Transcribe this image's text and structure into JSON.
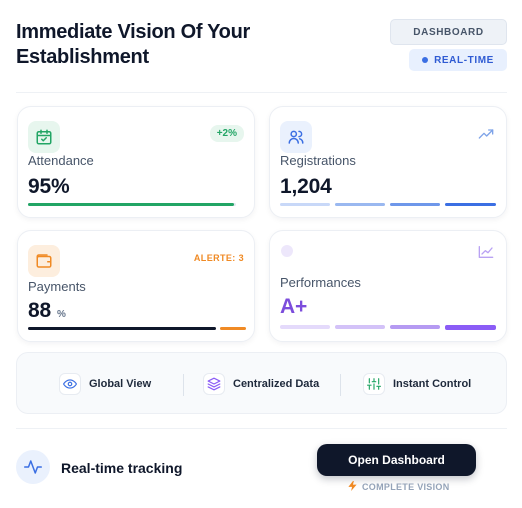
{
  "header": {
    "title": "Immediate Vision Of Your Establishment",
    "badge_dashboard": "DASHBOARD",
    "badge_realtime": "REAL-TIME"
  },
  "cards": {
    "attendance": {
      "label": "Attendance",
      "value": "95%",
      "badge": "+2%",
      "icon": "calendar-check-icon",
      "progress": 0.95
    },
    "registrations": {
      "label": "Registrations",
      "value": "1,204",
      "icon": "users-icon",
      "trend_icon": "trending-up-icon",
      "segments_filled": 4
    },
    "payments": {
      "label": "Payments",
      "value": "88",
      "unit": "%",
      "alert": "ALERTE: 3",
      "icon": "wallet-icon",
      "progress": 0.88
    },
    "performances": {
      "label": "Performances",
      "value": "A+",
      "icon": "chart-icon",
      "segments_filled": 4
    }
  },
  "features": [
    {
      "label": "Global View",
      "icon": "eye-icon"
    },
    {
      "label": "Centralized Data",
      "icon": "layers-icon"
    },
    {
      "label": "Instant Control",
      "icon": "sliders-icon"
    }
  ],
  "footer": {
    "tracking_label": "Real-time tracking",
    "tracking_icon": "activity-icon",
    "button_label": "Open Dashboard",
    "complete_label": "COMPLETE VISION",
    "complete_icon": "lightning-icon"
  },
  "colors": {
    "green": "#22a565",
    "blue": "#3b6fe3",
    "orange": "#f08a24",
    "purple": "#8b5cf6",
    "dark": "#0f172a"
  }
}
